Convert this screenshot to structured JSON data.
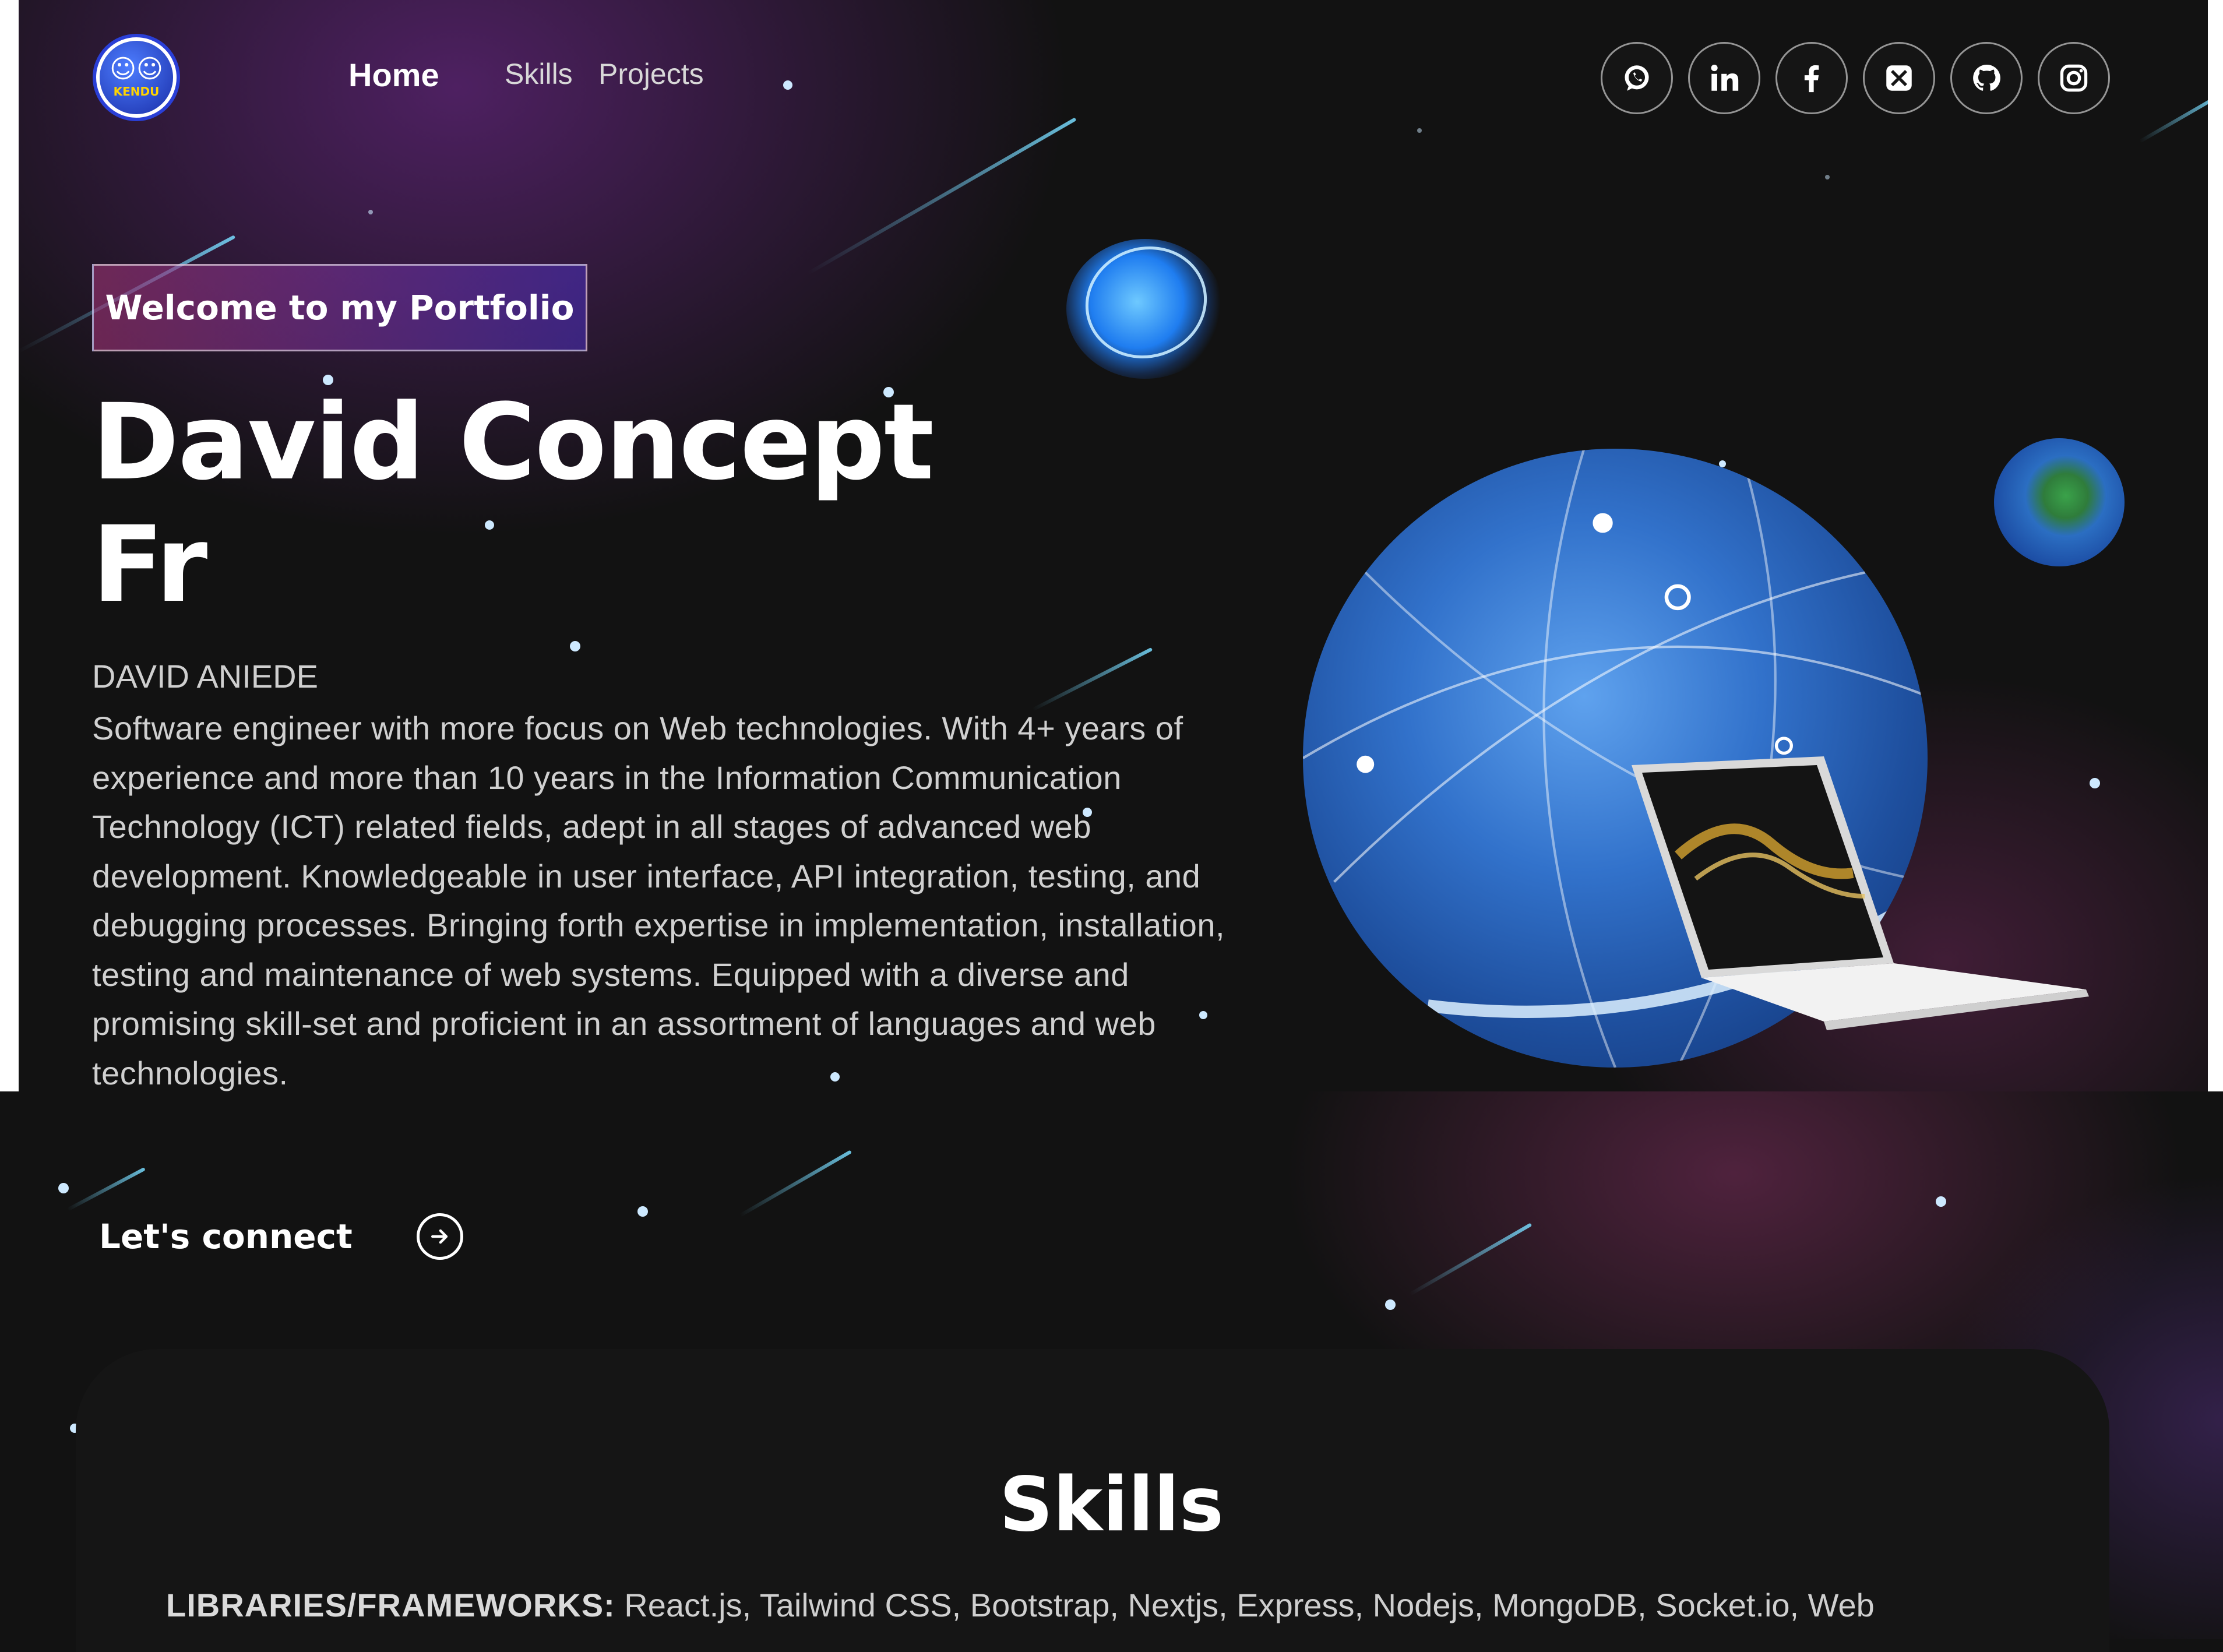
{
  "brand": {
    "logo_text": "KENDU"
  },
  "nav": {
    "home": "Home",
    "skills": "Skills",
    "projects": "Projects"
  },
  "socials": [
    "whatsapp",
    "linkedin",
    "facebook",
    "x",
    "github",
    "instagram"
  ],
  "hero": {
    "tagline": "Welcome to my Portfolio",
    "title_line1": "David Concept",
    "title_line2": "Fr",
    "name": "DAVID ANIEDE",
    "bio": "Software engineer with more focus on Web technologies. With 4+ years of experience and more than 10 years in the Information Communication Technology (ICT) related fields, adept in all stages of advanced web development. Knowledgeable in user interface, API integration, testing, and debugging processes. Bringing forth expertise in implementation, installation, testing and maintenance of web systems. Equipped with a diverse and promising skill-set and proficient in an assortment of languages and web technologies.",
    "connect_label": "Let's connect"
  },
  "skills": {
    "title": "Skills",
    "libraries_label": "LIBRARIES/FRAMEWORKS:",
    "libraries_value": " React.js, Tailwind CSS, Bootstrap, Nextjs, Express, Nodejs, MongoDB, Socket.io, Web"
  },
  "colors": {
    "background": "#121212",
    "tagline_gradient_start": "#aa367c",
    "tagline_gradient_end": "#4a2fbd",
    "accent_blue": "#2a3fd6"
  }
}
